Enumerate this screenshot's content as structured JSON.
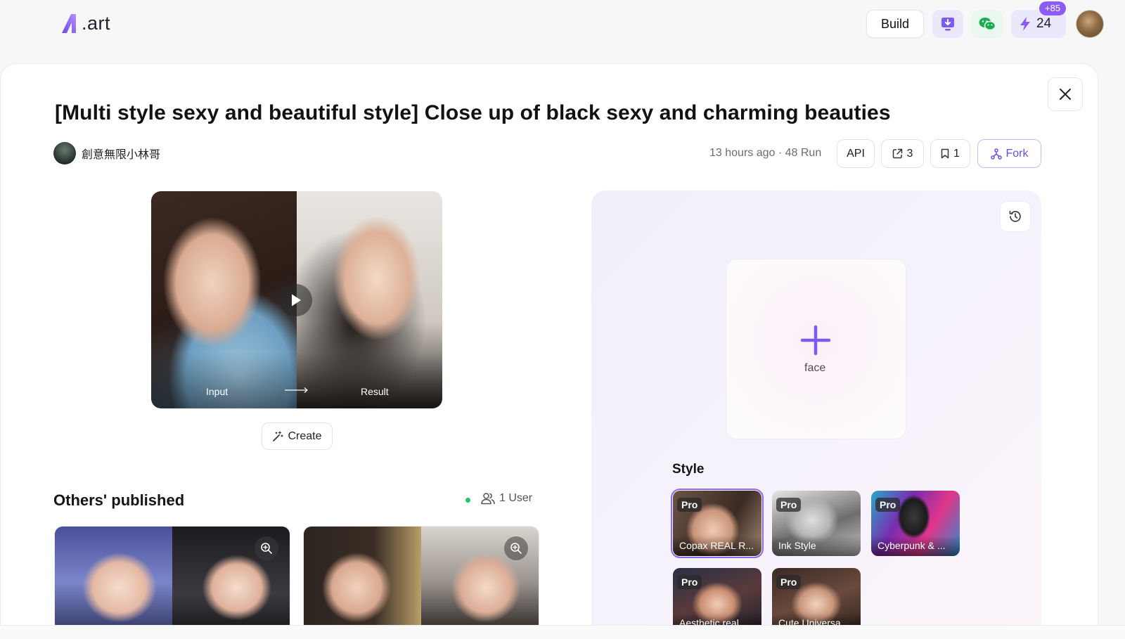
{
  "app": {
    "logo_text": ".art",
    "build_label": "Build",
    "credits_value": "24",
    "credits_badge": "+85",
    "colors": {
      "accent": "#8b5cf6",
      "online": "#22c55e",
      "fork": "#6d4de0"
    }
  },
  "icons": {
    "logo": "a-logo-icon",
    "download": "download-monitor-icon",
    "wechat": "wechat-icon",
    "credits": "lightning-icon",
    "close": "close-icon",
    "share": "share-icon",
    "bookmark": "bookmark-icon",
    "fork": "fork-icon",
    "play": "play-icon",
    "create": "magic-wand-icon",
    "users": "users-icon",
    "zoom": "zoom-in-icon",
    "history": "history-icon",
    "upload": "plus-icon"
  },
  "header": {
    "title": "[Multi style sexy and beautiful style] Close up of black sexy and charming beauties",
    "author": "創意無限小林哥",
    "meta": "13 hours ago · 48 Run",
    "api_label": "API",
    "share_count": "3",
    "bookmark_count": "1",
    "fork_label": "Fork"
  },
  "preview": {
    "input_label": "Input",
    "result_label": "Result",
    "create_label": "Create"
  },
  "others": {
    "title": "Others' published",
    "users_label": "1 User"
  },
  "panel": {
    "upload_label": "face",
    "style_label": "Style",
    "styles": [
      {
        "badge": "Pro",
        "name": "Copax REAL R...",
        "selected": true
      },
      {
        "badge": "Pro",
        "name": "Ink Style",
        "selected": false
      },
      {
        "badge": "Pro",
        "name": "Cyberpunk & ...",
        "selected": false
      },
      {
        "badge": "Pro",
        "name": "Aesthetic real...",
        "selected": false
      },
      {
        "badge": "Pro",
        "name": "Cute Universa...",
        "selected": false
      }
    ]
  }
}
